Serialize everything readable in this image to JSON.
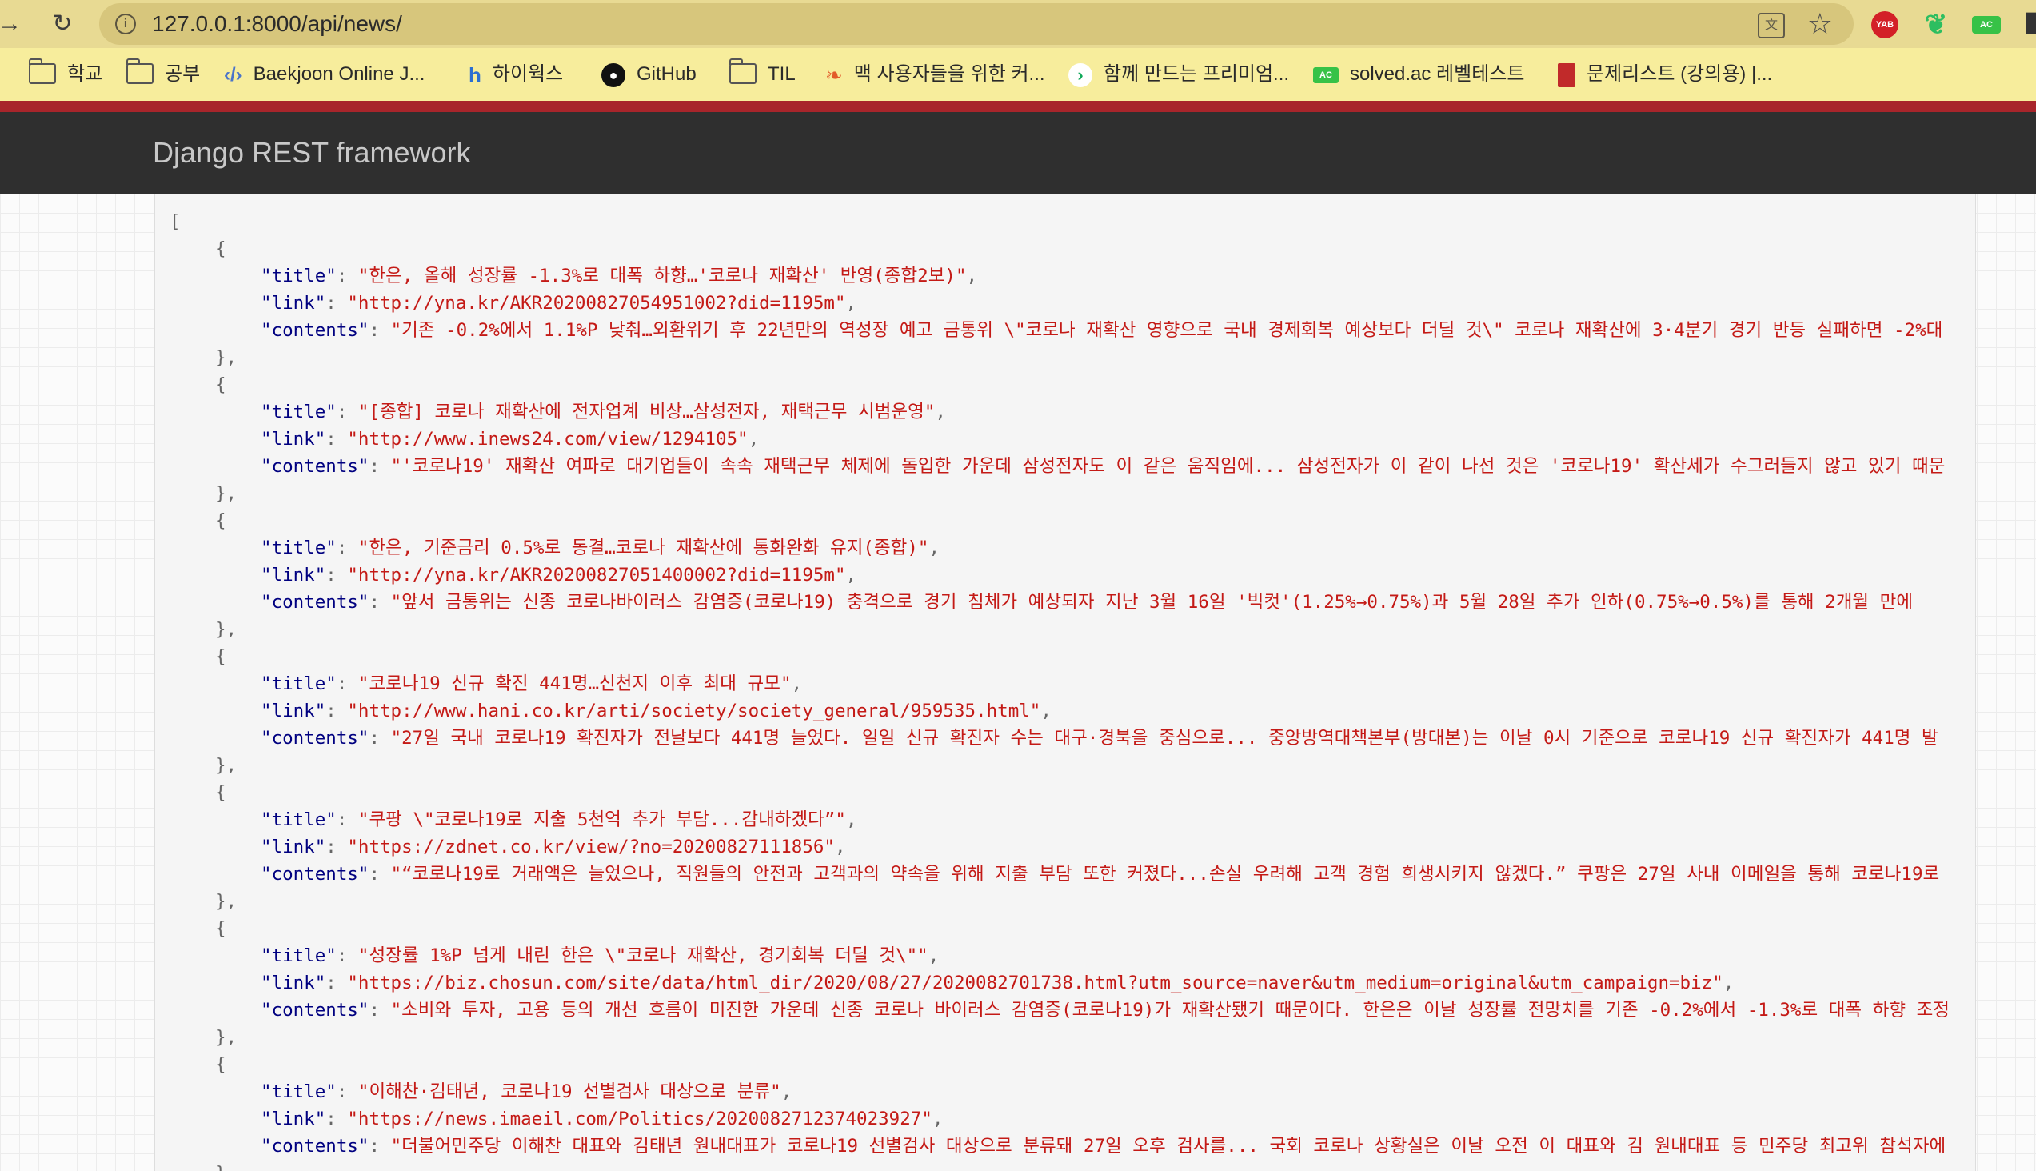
{
  "browser": {
    "url": "127.0.0.1:8000/api/news/",
    "extensions": {
      "yab": "YAB",
      "ac": "AC"
    }
  },
  "bookmarks": [
    {
      "label": "학교",
      "icon": "folder-icon"
    },
    {
      "label": "공부",
      "icon": "folder-icon"
    },
    {
      "label": "Baekjoon Online J...",
      "icon": "code-icon"
    },
    {
      "label": "하이웍스",
      "icon": "hiworks-icon"
    },
    {
      "label": "GitHub",
      "icon": "github-icon"
    },
    {
      "label": "TIL",
      "icon": "folder-icon"
    },
    {
      "label": "맥 사용자들을 위한 커...",
      "icon": "leaf-icon"
    },
    {
      "label": "함께 만드는 프리미엄...",
      "icon": "arrow-icon"
    },
    {
      "label": "solved.ac 레벨테스트",
      "icon": "ac-icon"
    },
    {
      "label": "문제리스트 (강의용) |...",
      "icon": "book-icon"
    }
  ],
  "navbar": {
    "brand": "Django REST framework"
  },
  "json_view": {
    "open_bracket": "[",
    "items": [
      {
        "title": "한은, 올해 성장률 -1.3%로 대폭 하향…'코로나 재확산' 반영(종합2보)",
        "link": "http://yna.kr/AKR20200827054951002?did=1195m",
        "contents": "기존 -0.2%에서 1.1%P 낮춰…외환위기 후 22년만의 역성장 예고 금통위 \\\"코로나 재확산 영향으로 국내 경제회복 예상보다 더딜 것\\\" 코로나 재확산에 3·4분기 경기 반등 실패하면 -2%대"
      },
      {
        "title": "[종합] 코로나 재확산에 전자업계 비상…삼성전자, 재택근무 시범운영",
        "link": "http://www.inews24.com/view/1294105",
        "contents": "'코로나19' 재확산 여파로 대기업들이 속속 재택근무 체제에 돌입한 가운데 삼성전자도 이 같은 움직임에... 삼성전자가 이 같이 나선 것은 '코로나19' 확산세가 수그러들지 않고 있기 때문"
      },
      {
        "title": "한은, 기준금리 0.5%로 동결…코로나 재확산에 통화완화 유지(종합)",
        "link": "http://yna.kr/AKR20200827051400002?did=1195m",
        "contents": "앞서 금통위는 신종 코로나바이러스 감염증(코로나19) 충격으로 경기 침체가 예상되자 지난 3월 16일 '빅컷'(1.25%→0.75%)과 5월 28일 추가 인하(0.75%→0.5%)를 통해 2개월 만에 "
      },
      {
        "title": "코로나19 신규 확진 441명…신천지 이후 최대 규모",
        "link": "http://www.hani.co.kr/arti/society/society_general/959535.html",
        "contents": "27일 국내 코로나19 확진자가 전날보다 441명 늘었다. 일일 신규 확진자 수는 대구·경북을 중심으로... 중앙방역대책본부(방대본)는 이날 0시 기준으로 코로나19 신규 확진자가 441명 발"
      },
      {
        "title": "쿠팡 \\\"코로나19로 지출 5천억 추가 부담...감내하겠다”",
        "link": "https://zdnet.co.kr/view/?no=20200827111856",
        "contents": "“코로나19로 거래액은 늘었으나, 직원들의 안전과 고객과의 약속을 위해 지출 부담 또한 커졌다...손실 우려해 고객 경험 희생시키지 않겠다.” 쿠팡은 27일 사내 이메일을 통해 코로나19로 "
      },
      {
        "title": "성장률 1%P 넘게 내린 한은 \\\"코로나 재확산, 경기회복 더딜 것\\\"",
        "link": "https://biz.chosun.com/site/data/html_dir/2020/08/27/2020082701738.html?utm_source=naver&utm_medium=original&utm_campaign=biz",
        "contents": "소비와 투자, 고용 등의 개선 흐름이 미진한 가운데 신종 코로나 바이러스 감염증(코로나19)가 재확산됐기 때문이다. 한은은 이날 성장률 전망치를 기존 -0.2%에서 -1.3%로 대폭 하향 조정"
      },
      {
        "title": "이해찬·김태년, 코로나19 선별검사 대상으로 분류",
        "link": "https://news.imaeil.com/Politics/2020082712374023927",
        "contents": "더불어민주당 이해찬 대표와 김태년 원내대표가 코로나19 선별검사 대상으로 분류돼 27일 오후 검사를... 국회 코로나 상황실은 이날 오전 이 대표와 김 원내대표 등 민주당 최고위 참석자에"
      }
    ]
  }
}
